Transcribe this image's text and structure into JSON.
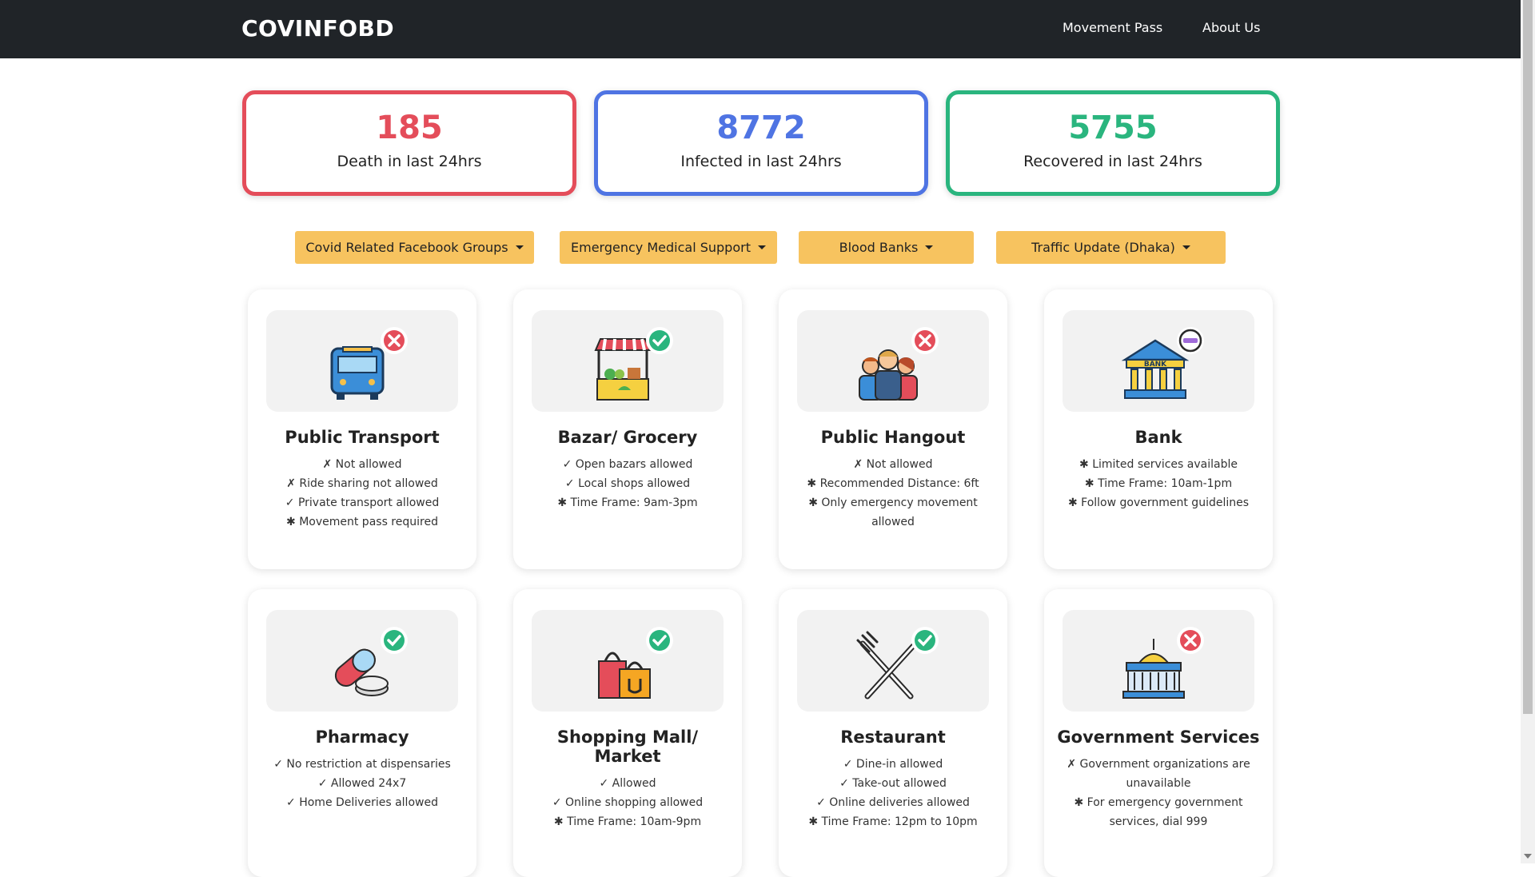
{
  "nav": {
    "brand": "COVINFOBD",
    "links": [
      "Movement Pass",
      "About Us"
    ]
  },
  "stats": [
    {
      "value": "185",
      "label": "Death in last 24hrs",
      "color": "#e44d5a"
    },
    {
      "value": "8772",
      "label": "Infected in last 24hrs",
      "color": "#4f74e3"
    },
    {
      "value": "5755",
      "label": "Recovered in last 24hrs",
      "color": "#2ab57e"
    }
  ],
  "dropdowns": [
    "Covid Related Facebook Groups",
    "Emergency Medical Support",
    "Blood Banks",
    "Traffic Update (Dhaka)"
  ],
  "colors": {
    "navbar": "#202428",
    "button": "#f7c35f",
    "allowed": "#2ab57e",
    "denied": "#e44d5a",
    "limited": "#a06bd9"
  },
  "cards": [
    {
      "title": "Public Transport",
      "icon": "bus-icon",
      "status": "not-allowed",
      "lines": [
        "✗ Not allowed",
        "✗ Ride sharing not allowed",
        "✓ Private transport allowed",
        "✱ Movement pass required"
      ]
    },
    {
      "title": "Bazar/ Grocery",
      "icon": "grocery-stall-icon",
      "status": "allowed",
      "lines": [
        "✓ Open bazars allowed",
        "✓ Local shops allowed",
        "✱ Time Frame: 9am-3pm"
      ]
    },
    {
      "title": "Public Hangout",
      "icon": "people-group-icon",
      "status": "not-allowed",
      "lines": [
        "✗ Not allowed",
        "✱ Recommended Distance: 6ft",
        "✱ Only emergency movement allowed"
      ]
    },
    {
      "title": "Bank",
      "icon": "bank-icon",
      "status": "limited",
      "lines": [
        "✱ Limited services available",
        "✱ Time Frame: 10am-1pm",
        "✱ Follow government guidelines"
      ]
    },
    {
      "title": "Pharmacy",
      "icon": "pills-icon",
      "status": "allowed",
      "lines": [
        "✓ No restriction at dispensaries",
        "✓ Allowed 24x7",
        "✓ Home Deliveries allowed"
      ]
    },
    {
      "title": "Shopping Mall/ Market",
      "icon": "shopping-bags-icon",
      "status": "allowed",
      "lines": [
        "✓ Allowed",
        "✓ Online shopping allowed",
        "✱ Time Frame: 10am-9pm"
      ]
    },
    {
      "title": "Restaurant",
      "icon": "fork-knife-icon",
      "status": "allowed",
      "lines": [
        "✓ Dine-in allowed",
        "✓ Take-out allowed",
        "✓ Online deliveries allowed",
        "✱ Time Frame: 12pm to 10pm"
      ]
    },
    {
      "title": "Government Services",
      "icon": "government-building-icon",
      "status": "not-allowed",
      "lines": [
        "✗ Government organizations are unavailable",
        "✱ For emergency government services, dial 999"
      ]
    }
  ]
}
